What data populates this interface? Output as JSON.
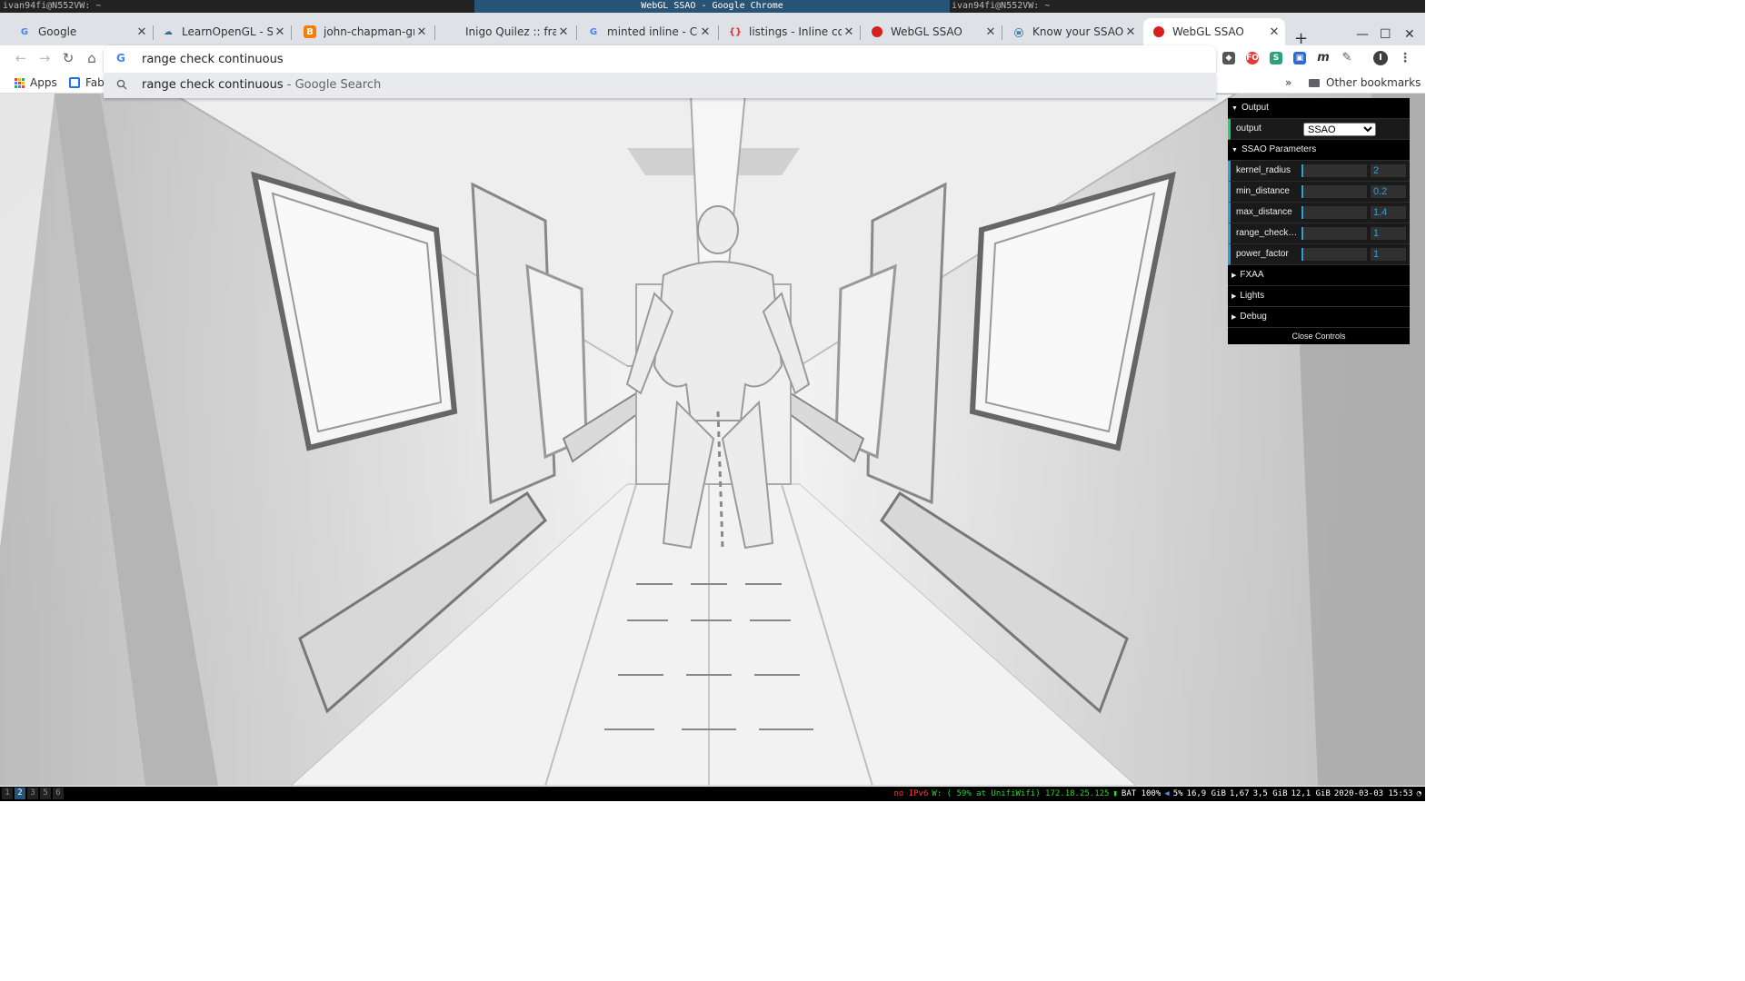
{
  "wm": {
    "left_title": "ivan94fi@N552VW: ~",
    "center_title": "WebGL SSAO - Google Chrome",
    "right_title": "ivan94fi@N552VW: ~"
  },
  "tabs": [
    {
      "title": "Google",
      "icon": "google-icon"
    },
    {
      "title": "LearnOpenGL - SSA",
      "icon": "learnopengl-icon"
    },
    {
      "title": "john-chapman-grap",
      "icon": "blogger-icon"
    },
    {
      "title": "Inigo Quilez :: fract",
      "icon": ""
    },
    {
      "title": "minted inline - Cerc",
      "icon": "google-icon"
    },
    {
      "title": "listings - Inline cod",
      "icon": "braces-icon"
    },
    {
      "title": "WebGL SSAO",
      "icon": "red-dot-icon"
    },
    {
      "title": "Know your SSAO ar",
      "icon": "wordpress-icon"
    },
    {
      "title": "WebGL SSAO",
      "icon": "red-dot-icon"
    }
  ],
  "omnibox": {
    "value": "range check continuous"
  },
  "suggestion": {
    "query": "range check continuous",
    "source": " - Google Search"
  },
  "bookmarks": {
    "apps": "Apps",
    "item": "Fabl",
    "overflow": "»",
    "other": "Other bookmarks"
  },
  "gui": {
    "output_folder": "Output",
    "output_label": "output",
    "output_value": "SSAO",
    "ssao_folder": "SSAO Parameters",
    "params": [
      {
        "name": "kernel_radius",
        "value": "2",
        "fill": 0.03
      },
      {
        "name": "min_distance",
        "value": "0.2",
        "fill": 0.01
      },
      {
        "name": "max_distance",
        "value": "1.4",
        "fill": 0.01
      },
      {
        "name": "range_check_fa...",
        "value": "1",
        "fill": 0.0
      },
      {
        "name": "power_factor",
        "value": "1",
        "fill": 0.0
      }
    ],
    "fxaa_folder": "FXAA",
    "lights_folder": "Lights",
    "debug_folder": "Debug",
    "close": "Close Controls"
  },
  "status": {
    "workspaces": [
      "1",
      "2",
      "3",
      "5",
      "6"
    ],
    "active_workspace": "2",
    "ipv6": "no IPv6",
    "wifi": "W: ( 59% at UnifiWifi) 172.18.25.125",
    "battery": "BAT 100%",
    "volume": "5%",
    "disk": "16,9 GiB",
    "load": "1,67",
    "mem1": "3,5 GiB",
    "mem2": "12,1 GiB",
    "datetime": "2020-03-03 15:53"
  },
  "colors": {
    "gui_accent": "#2fa1d6",
    "gui_select_accent": "#1ed36f",
    "wm_title_bg": "#285577",
    "status_ipv6": "#ff3b3b",
    "status_wifi": "#2fd62f"
  }
}
